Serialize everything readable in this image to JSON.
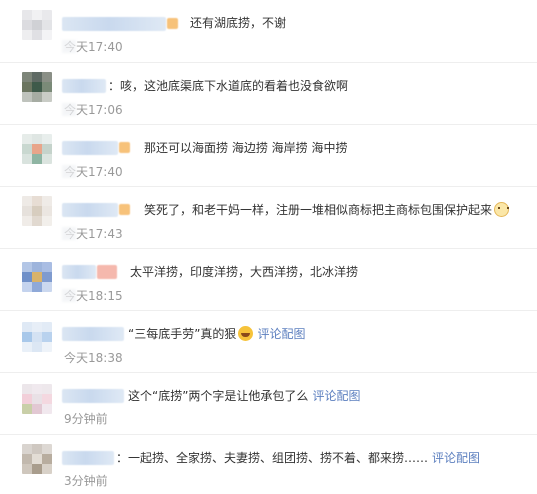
{
  "comments": [
    {
      "text": "还有湖底捞，不谢",
      "time": "今天17:40",
      "has_link": false
    },
    {
      "text": "：咳，这池底渠底下水道底的看着也没食欲啊",
      "time": "今天17:06",
      "has_link": false
    },
    {
      "text": "那还可以海面捞 海边捞 海岸捞 海中捞",
      "time": "今天17:40",
      "has_link": false
    },
    {
      "text": "笑死了，和老干妈一样，注册一堆相似商标把主商标包围保护起来",
      "time": "今天17:43",
      "has_link": false,
      "emoji": "cat-icon"
    },
    {
      "text": "太平洋捞，印度洋捞，大西洋捞，北冰洋捞",
      "time": "今天18:15",
      "has_link": false
    },
    {
      "text": "“三每底手劳”真的狠",
      "time": "今天18:38",
      "has_link": true,
      "link": "评论配图",
      "emoji": "laugh-icon"
    },
    {
      "text": "这个“底捞”两个字是让他承包了么",
      "time": "9分钟前",
      "has_link": true,
      "link": "评论配图"
    },
    {
      "text": "：一起捞、全家捞、夫妻捞、组团捞、捞不着、都来捞……",
      "time": "3分钟前",
      "has_link": true,
      "link": "评论配图"
    }
  ],
  "colors": {
    "link": "#5c7fbf",
    "time": "#999999",
    "text": "#333333",
    "divider": "#eeeeee"
  }
}
